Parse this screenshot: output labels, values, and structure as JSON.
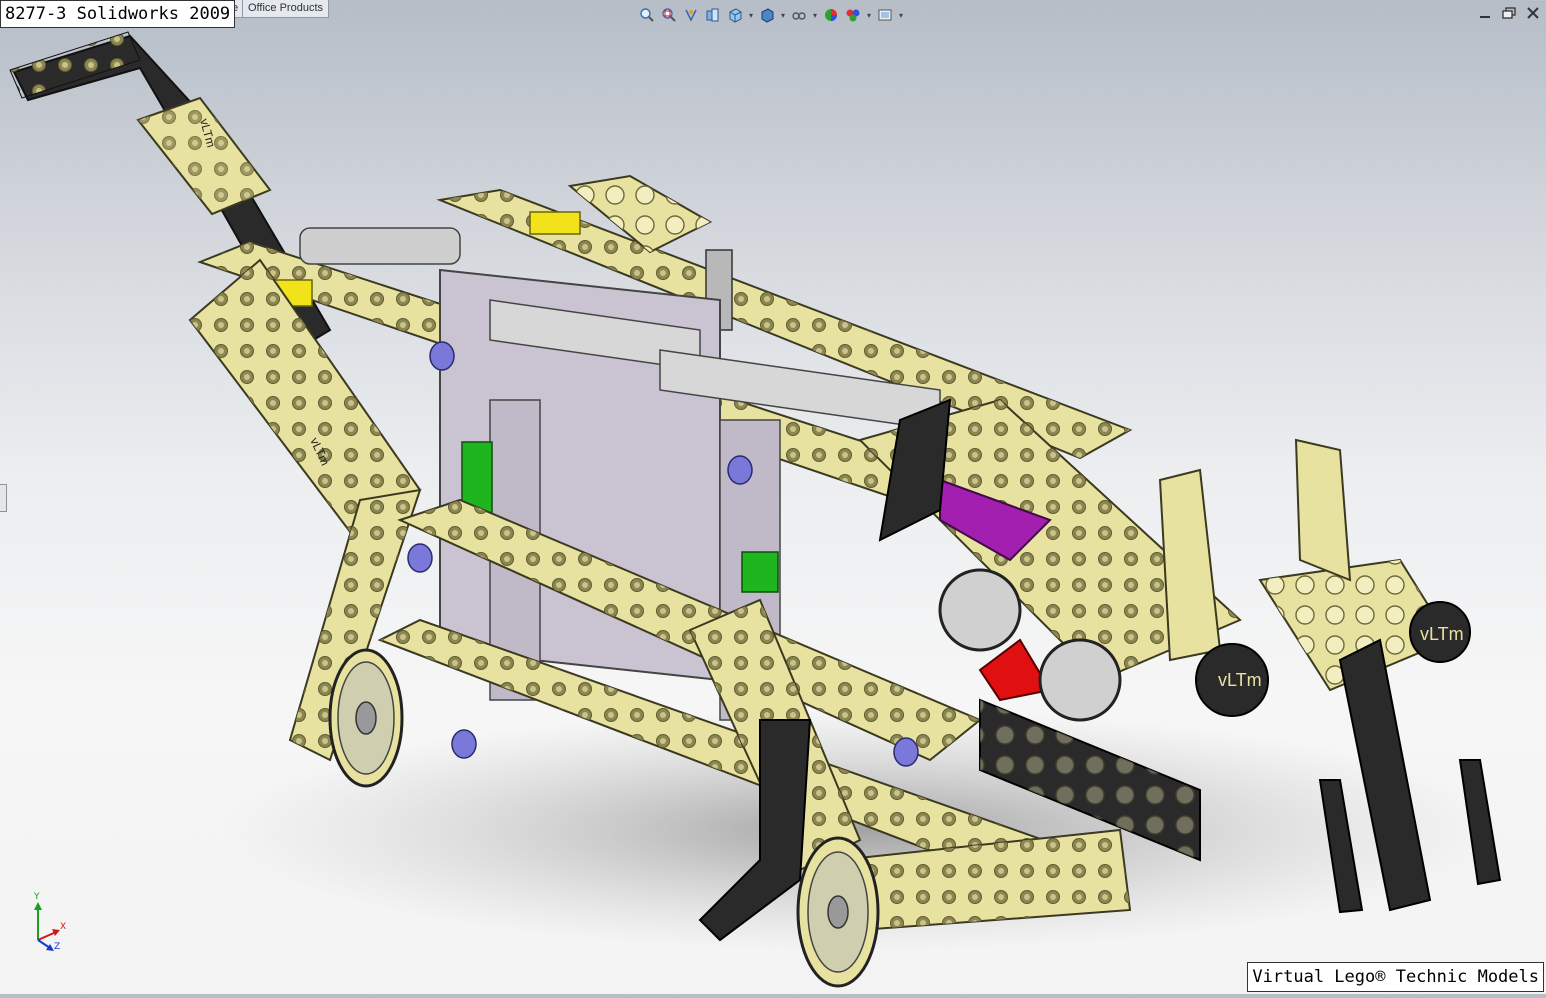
{
  "window": {
    "title": "8277-3 Solidworks 2009"
  },
  "tabs": [
    {
      "label": "e"
    },
    {
      "label": "Office Products"
    }
  ],
  "toolbar": {
    "icons": [
      "zoom-to-fit-icon",
      "zoom-area-icon",
      "previous-view-icon",
      "section-view-icon",
      "view-orientation-icon",
      "display-style-icon",
      "hide-show-items-icon",
      "edit-appearance-icon",
      "apply-scene-icon",
      "view-settings-icon"
    ]
  },
  "watermark": {
    "text": "Virtual Lego® Technic Models"
  },
  "triad": {
    "x": "X",
    "y": "Y",
    "z": "Z"
  },
  "model": {
    "beam_color": "#e7e2a0",
    "beam_hole_color": "#8c8650",
    "black_part_color": "#2a2a2a",
    "grey_part_color": "#c9c3d2",
    "green_part_color": "#1fb51f",
    "blue_bush_color": "#7a78d8",
    "yellow_pin_color": "#f2e21a",
    "purple_plate_color": "#a21fb0",
    "red_slope_color": "#e01010",
    "vltm_labels": [
      "vLTm",
      "vLTm",
      "vLTm",
      "vLTm",
      "vLTm",
      "vLTm",
      "vLTm",
      "vLTm"
    ]
  }
}
